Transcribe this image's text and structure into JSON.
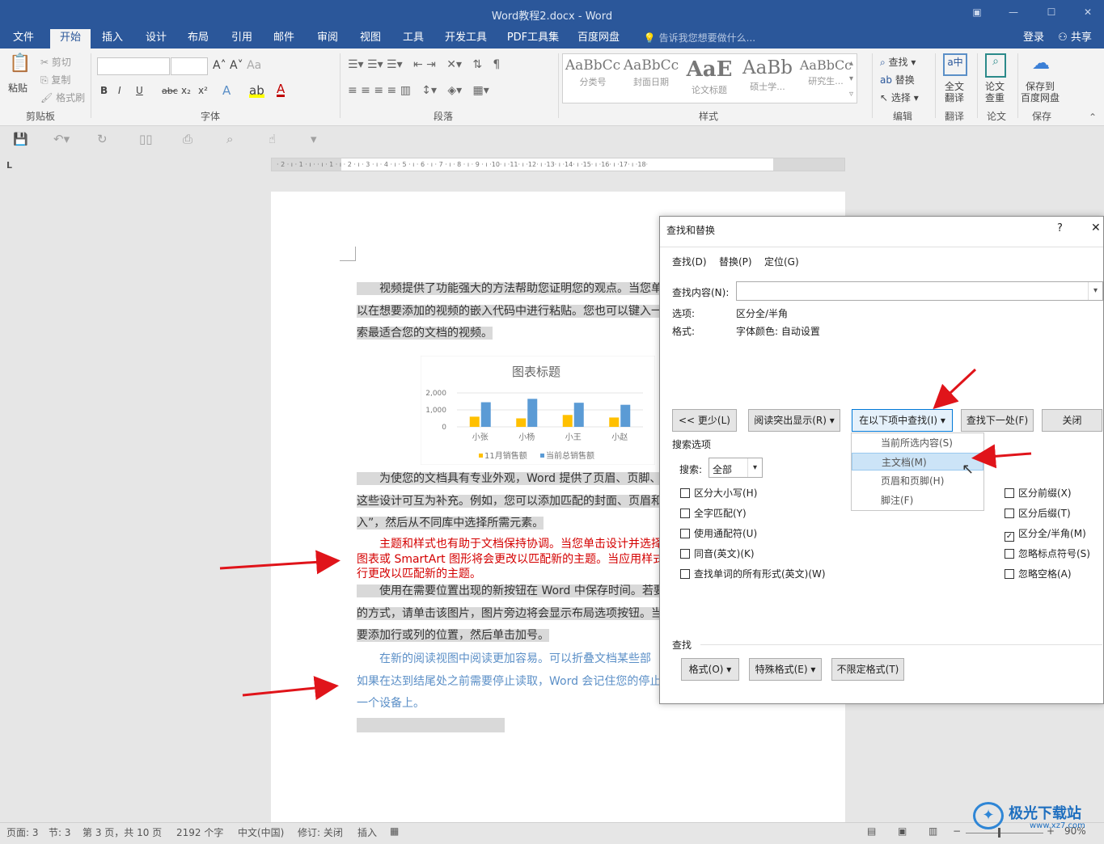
{
  "titlebar": {
    "title": "Word教程2.docx - Word"
  },
  "menubar": {
    "tabs": [
      "文件",
      "开始",
      "插入",
      "设计",
      "布局",
      "引用",
      "邮件",
      "审阅",
      "视图",
      "工具",
      "开发工具",
      "PDF工具集",
      "百度网盘"
    ],
    "tell_me": "告诉我您想要做什么...",
    "login": "登录",
    "share": "共享"
  },
  "ribbon": {
    "clipboard": {
      "paste": "粘贴",
      "cut": "剪切",
      "copy": "复制",
      "format_painter": "格式刷",
      "group": "剪贴板"
    },
    "font": {
      "group": "字体",
      "bold": "B",
      "italic": "I",
      "underline": "U",
      "strike": "abc",
      "sub": "x₂",
      "sup": "x²"
    },
    "paragraph": {
      "group": "段落"
    },
    "styles": {
      "group": "样式",
      "items": [
        {
          "preview": "AaBbCc",
          "caption": "分类号"
        },
        {
          "preview": "AaBbCc",
          "caption": "封面日期"
        },
        {
          "preview": "AaE",
          "caption": "论文标题"
        },
        {
          "preview": "AaBb",
          "caption": "硕士学..."
        },
        {
          "preview": "AaBbCc",
          "caption": "研究生..."
        }
      ]
    },
    "editing": {
      "group": "编辑",
      "find": "查找",
      "replace": "替换",
      "select": "选择"
    },
    "translate": {
      "group": "翻译",
      "label1": "全文",
      "label2": "翻译"
    },
    "paper": {
      "group": "论文",
      "label1": "论文",
      "label2": "查重"
    },
    "save": {
      "group": "保存",
      "label1": "保存到",
      "label2": "百度网盘"
    }
  },
  "ruler": {
    "text": "· 2 · ı · 1 · ı ·   · ı · 1 · ı · 2 · ı · 3 · ı · 4 · ı · 5 · ı · 6 · ı · 7 · ı · 8 · ı · 9 · ı ·10· ı ·11· ı ·12· ı ·13· ı ·14· ı ·15· ı ·16· ı ·17· ı ·18·"
  },
  "document": {
    "p1": [
      "　　视频提供了功能强大的方法帮助您证明您的观点。当您单",
      "以在想要添加的视频的嵌入代码中进行粘贴。您也可以键入一",
      "索最适合您的文档的视频。"
    ],
    "p2": [
      "　　为使您的文档具有专业外观，Word  提供了页眉、页脚、",
      "这些设计可互为补充。例如，您可以添加匹配的封面、页眉和",
      "入”，然后从不同库中选择所需元素。"
    ],
    "p3": [
      "　　主题和样式也有助于文档保持协调。当您单击设计并选择",
      "图表或 SmartArt 图形将会更改以匹配新的主题。当应用样式",
      "行更改以匹配新的主题。"
    ],
    "p4": [
      "　　使用在需要位置出现的新按钮在 Word 中保存时间。若要",
      "的方式，请单击该图片，图片旁边将会显示布局选项按钮。当",
      "要添加行或列的位置，然后单击加号。"
    ],
    "p5": [
      "　　在新的阅读视图中阅读更加容易。可以折叠文档某些部",
      "如果在达到结尾处之前需要停止读取，Word 会记住您的停止",
      "一个设备上。"
    ]
  },
  "chart_data": {
    "type": "bar",
    "title": "图表标题",
    "categories": [
      "小张",
      "小杨",
      "小王",
      "小赵"
    ],
    "series": [
      {
        "name": "11月销售额",
        "values": [
          600,
          500,
          700,
          550
        ],
        "color": "#ffc000"
      },
      {
        "name": "当前总销售额",
        "values": [
          1450,
          1650,
          1420,
          1300
        ],
        "color": "#5b9bd5"
      }
    ],
    "ylim": [
      0,
      2000
    ],
    "yticks": [
      "2,000",
      "1,000",
      "0"
    ],
    "legend": "bottom"
  },
  "dialog": {
    "title": "查找和替换",
    "help": "?",
    "close": "✕",
    "tabs": [
      "查找(D)",
      "替换(P)",
      "定位(G)"
    ],
    "find_label": "查找内容(N):",
    "find_value": "",
    "options_label": "选项:",
    "options_value": "区分全/半角",
    "format_label": "格式:",
    "format_value": "字体颜色: 自动设置",
    "buttons": {
      "less": "<< 更少(L)",
      "highlight": "阅读突出显示(R) ▾",
      "find_in": "在以下项中查找(I) ▾",
      "find_next": "查找下一处(F)",
      "close": "关闭"
    },
    "search_options": "搜索选项",
    "search_label": "搜索:",
    "search_value": "全部",
    "left_checks": [
      {
        "label": "区分大小写(H)",
        "checked": false
      },
      {
        "label": "全字匹配(Y)",
        "checked": false
      },
      {
        "label": "使用通配符(U)",
        "checked": false
      },
      {
        "label": "同音(英文)(K)",
        "checked": false
      },
      {
        "label": "查找单词的所有形式(英文)(W)",
        "checked": false
      }
    ],
    "right_checks": [
      {
        "label": "区分前缀(X)",
        "checked": false
      },
      {
        "label": "区分后缀(T)",
        "checked": false
      },
      {
        "label": "区分全/半角(M)",
        "checked": true
      },
      {
        "label": "忽略标点符号(S)",
        "checked": false
      },
      {
        "label": "忽略空格(A)",
        "checked": false
      }
    ],
    "find_section": "查找",
    "bottom_buttons": [
      "格式(O) ▾",
      "特殊格式(E) ▾",
      "不限定格式(T)"
    ],
    "dropdown": [
      "当前所选内容(S)",
      "主文档(M)",
      "页眉和页脚(H)",
      "脚注(F)"
    ]
  },
  "statusbar": {
    "page": "页面: 3",
    "section": "节: 3",
    "pages": "第 3 页，共 10 页",
    "words": "2192 个字",
    "lang": "中文(中国)",
    "track": "修订: 关闭",
    "insert": "插入",
    "zoom": "90%"
  },
  "watermark": {
    "text": "极光下载站",
    "url": "www.xz7.com"
  }
}
